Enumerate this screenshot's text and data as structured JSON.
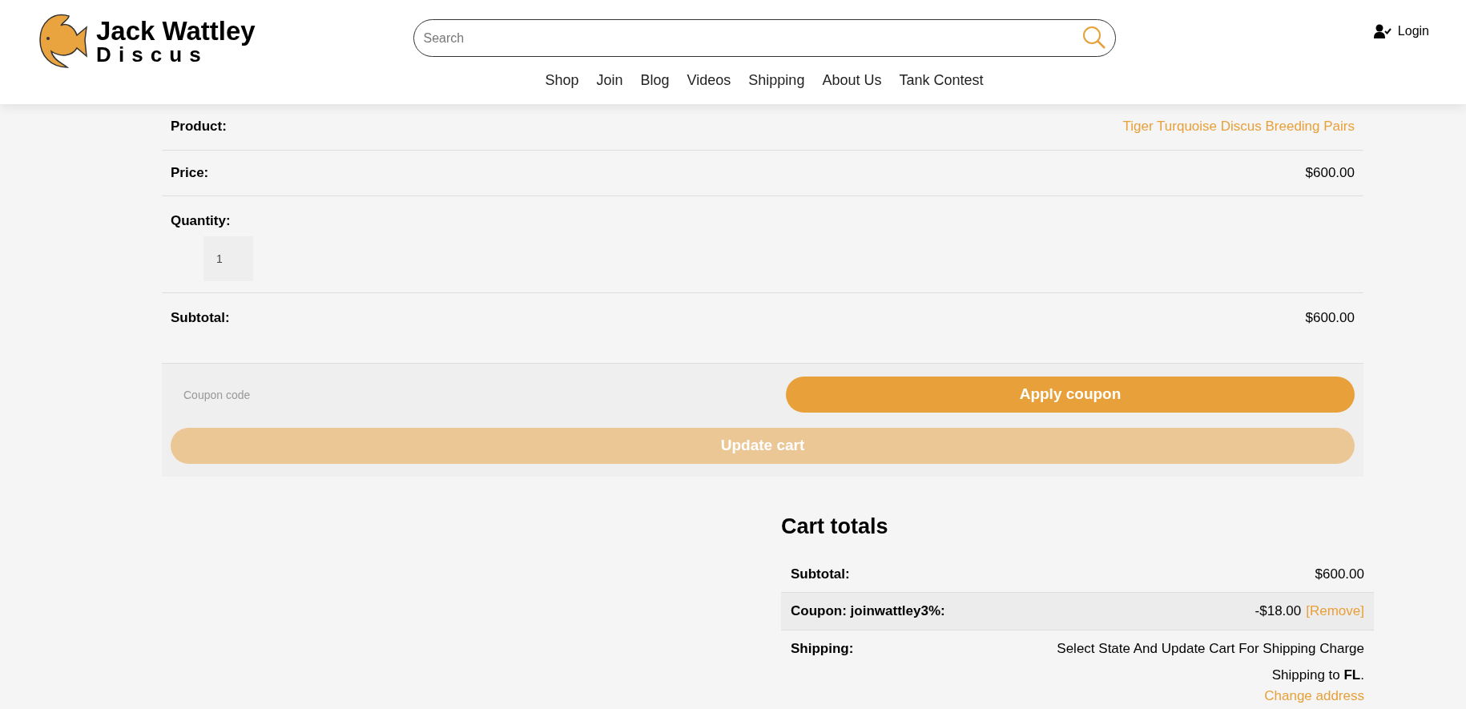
{
  "header": {
    "logo": {
      "line_1": "Jack Wattley",
      "line_2": "Discus"
    },
    "search": {
      "placeholder": "Search"
    },
    "login": "Login",
    "nav": [
      "Shop",
      "Join",
      "Blog",
      "Videos",
      "Shipping",
      "About Us",
      "Tank Contest"
    ]
  },
  "cart_item": {
    "rows": [
      {
        "kind": "link",
        "label": "Product:",
        "value": "Tiger Turquoise Discus Breeding Pairs"
      },
      {
        "kind": "text",
        "label": "Price:",
        "value": "$600.00"
      },
      {
        "kind": "quantity",
        "label": "Quantity:",
        "value": "1"
      },
      {
        "kind": "text",
        "label": "Subtotal:",
        "value": "$600.00"
      }
    ]
  },
  "coupon": {
    "placeholder": "Coupon code",
    "apply_button": "Apply coupon",
    "update_button": {
      "label": "Update cart",
      "disabled": true
    }
  },
  "cart_totals": {
    "title": "Cart totals",
    "rows": [
      {
        "kind": "text",
        "label": "Subtotal:",
        "value": "$600.00"
      },
      {
        "kind": "coupon",
        "label": "Coupon: joinwattley3%:",
        "value": "-$18.00",
        "link": "[Remove]"
      },
      {
        "kind": "shipping",
        "label": "Shipping:",
        "value": "Select State And Update Cart For Shipping Charge",
        "note": "Shipping to **FL**.",
        "link": "Change address"
      }
    ]
  }
}
